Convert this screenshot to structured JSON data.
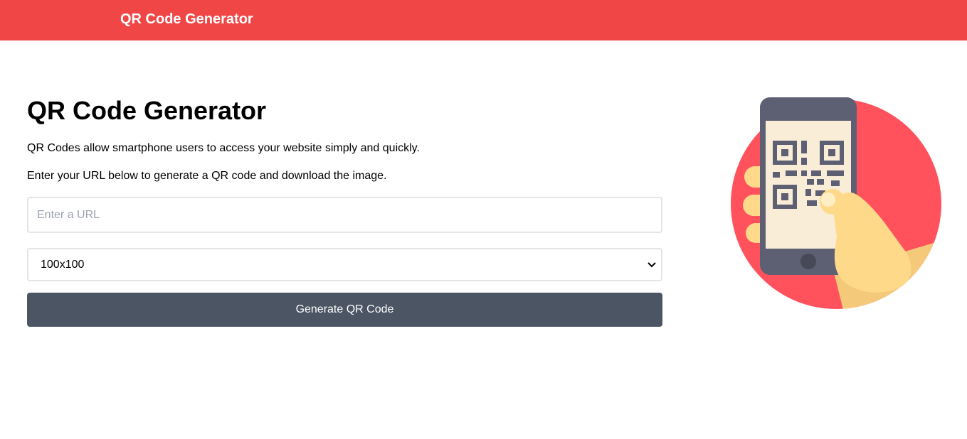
{
  "header": {
    "brand": "QR Code Generator"
  },
  "main": {
    "title": "QR Code Generator",
    "description": "QR Codes allow smartphone users to access your website simply and quickly.",
    "instructions": "Enter your URL below to generate a QR code and download the image.",
    "url_input": {
      "value": "",
      "placeholder": "Enter a URL"
    },
    "size_select": {
      "selected": "100x100"
    },
    "generate_button": "Generate QR Code"
  },
  "illustration": {
    "icon": "phone-scanning-qr-code-icon"
  },
  "colors": {
    "header_bg": "#f04646",
    "button_bg": "#4b5563",
    "circle": "#ff525d",
    "phone_body": "#5d5f73",
    "phone_screen": "#faedd8",
    "hand": "#ffd98a",
    "hand_shadow": "#f5c97a"
  }
}
